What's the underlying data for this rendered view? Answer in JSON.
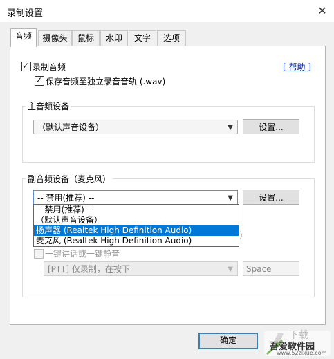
{
  "window": {
    "title": "录制设置",
    "close_glyph": "✕"
  },
  "tabs": [
    "音频",
    "摄像头",
    "鼠标",
    "水印",
    "文字",
    "选项"
  ],
  "audio": {
    "record_audio_label": "录制音频",
    "save_separate_label": "保存音频至独立录音音轨 (.wav)",
    "help_link": "[ 帮助 ]",
    "main_device_group": "主音频设备",
    "main_device_value": "（默认声音设备）",
    "settings_button": "设置...",
    "secondary_group": "副音频设备（麦克风）",
    "secondary_value": "-- 禁用(推荐) --",
    "secondary_options": [
      "-- 禁用(推荐) --",
      "（默认声音设备）",
      "扬声器 (Realtek High Definition Audio)",
      "麦克风 (Realtek High Definition Audio)"
    ],
    "highlighted_option_index": 2,
    "partial_paren": ")",
    "ptt_label": "一键讲话或一键静音",
    "ptt_mode_value": "[PTT] 仅录制，在按下",
    "ptt_key_value": "Space"
  },
  "footer": {
    "ok_button": "确定"
  },
  "watermark": {
    "logo_text": "下载",
    "site_name": "吾爱软件园",
    "site_url": "www.52zixue.com"
  },
  "icons": {
    "dropdown_arrow": "chevron-down-icon",
    "checkbox_check": "check-icon"
  }
}
